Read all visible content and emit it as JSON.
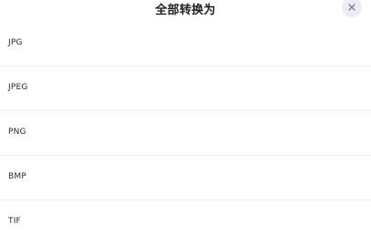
{
  "dialog": {
    "title": "全部转换为",
    "close_icon": "close-icon"
  },
  "formats": [
    {
      "label": "JPG"
    },
    {
      "label": "JPEG"
    },
    {
      "label": "PNG"
    },
    {
      "label": "BMP"
    },
    {
      "label": "TIF"
    }
  ],
  "colors": {
    "title": "#1f1f1f",
    "close_bg": "#ebedf2",
    "close_icon": "#7a7f8a",
    "divider": "#eeeeee"
  }
}
